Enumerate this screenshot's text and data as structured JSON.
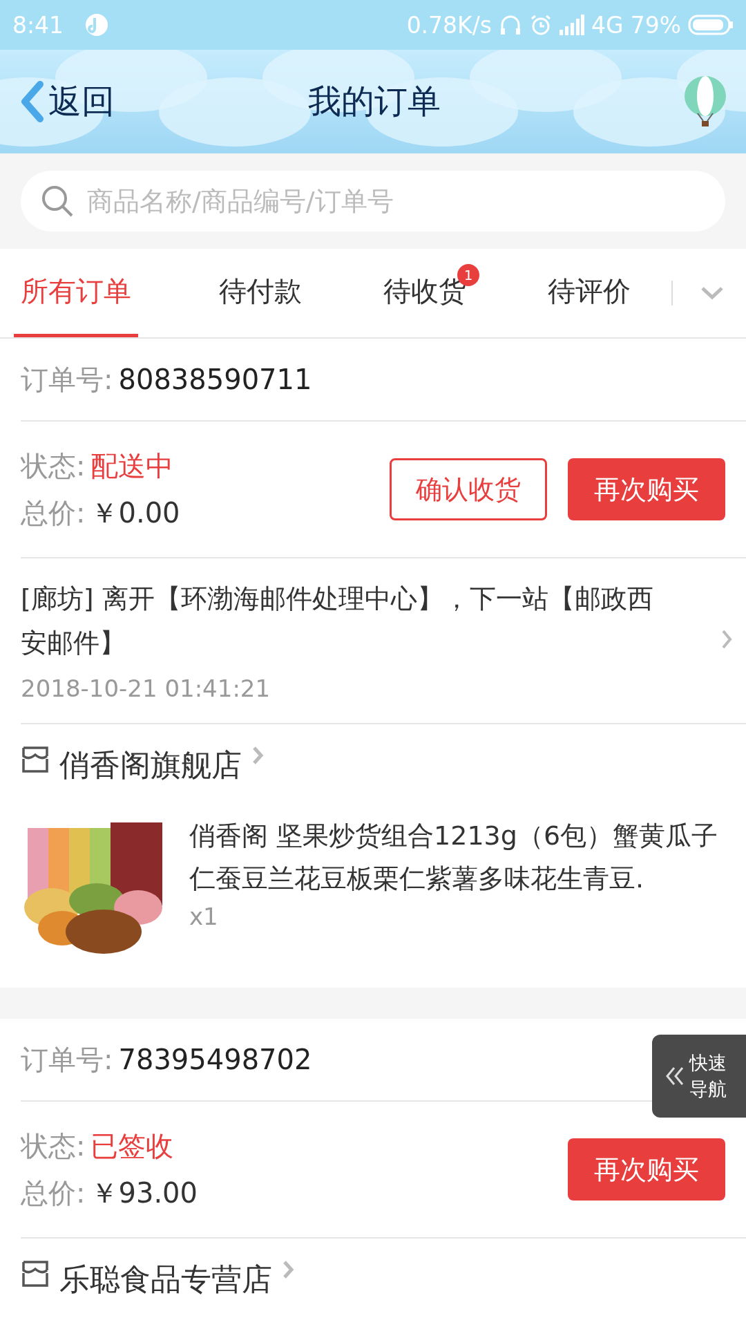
{
  "status_bar": {
    "time": "8:41",
    "speed": "0.78K/s",
    "network": "4G",
    "battery": "79%"
  },
  "header": {
    "back_label": "返回",
    "title": "我的订单"
  },
  "search": {
    "placeholder": "商品名称/商品编号/订单号"
  },
  "tabs": [
    {
      "label": "所有订单",
      "selected": true
    },
    {
      "label": "待付款",
      "selected": false
    },
    {
      "label": "待收货",
      "selected": false,
      "badge": "1"
    },
    {
      "label": "待评价",
      "selected": false
    }
  ],
  "orders": [
    {
      "order_no_label": "订单号:",
      "order_no": "80838590711",
      "status_label": "状态:",
      "status": "配送中",
      "total_label": "总价:",
      "total": "￥0.00",
      "buttons": [
        {
          "label": "确认收货",
          "kind": "outline"
        },
        {
          "label": "再次购买",
          "kind": "filled"
        }
      ],
      "tracking": {
        "text": "[廊坊] 离开【环渤海邮件处理中心】，下一站【邮政西安邮件】",
        "time": "2018-10-21 01:41:21"
      },
      "store": "俏香阁旗舰店",
      "product": {
        "title": "俏香阁 坚果炒货组合1213g（6包）蟹黄瓜子仁蚕豆兰花豆板栗仁紫薯多味花生青豆.",
        "qty": "x1"
      }
    },
    {
      "order_no_label": "订单号:",
      "order_no": "78395498702",
      "status_label": "状态:",
      "status": "已签收",
      "total_label": "总价:",
      "total": "￥93.00",
      "buttons": [
        {
          "label": "再次购买",
          "kind": "filled"
        }
      ],
      "store": "乐聪食品专营店"
    }
  ],
  "quick_nav": {
    "label": "快速导航"
  }
}
